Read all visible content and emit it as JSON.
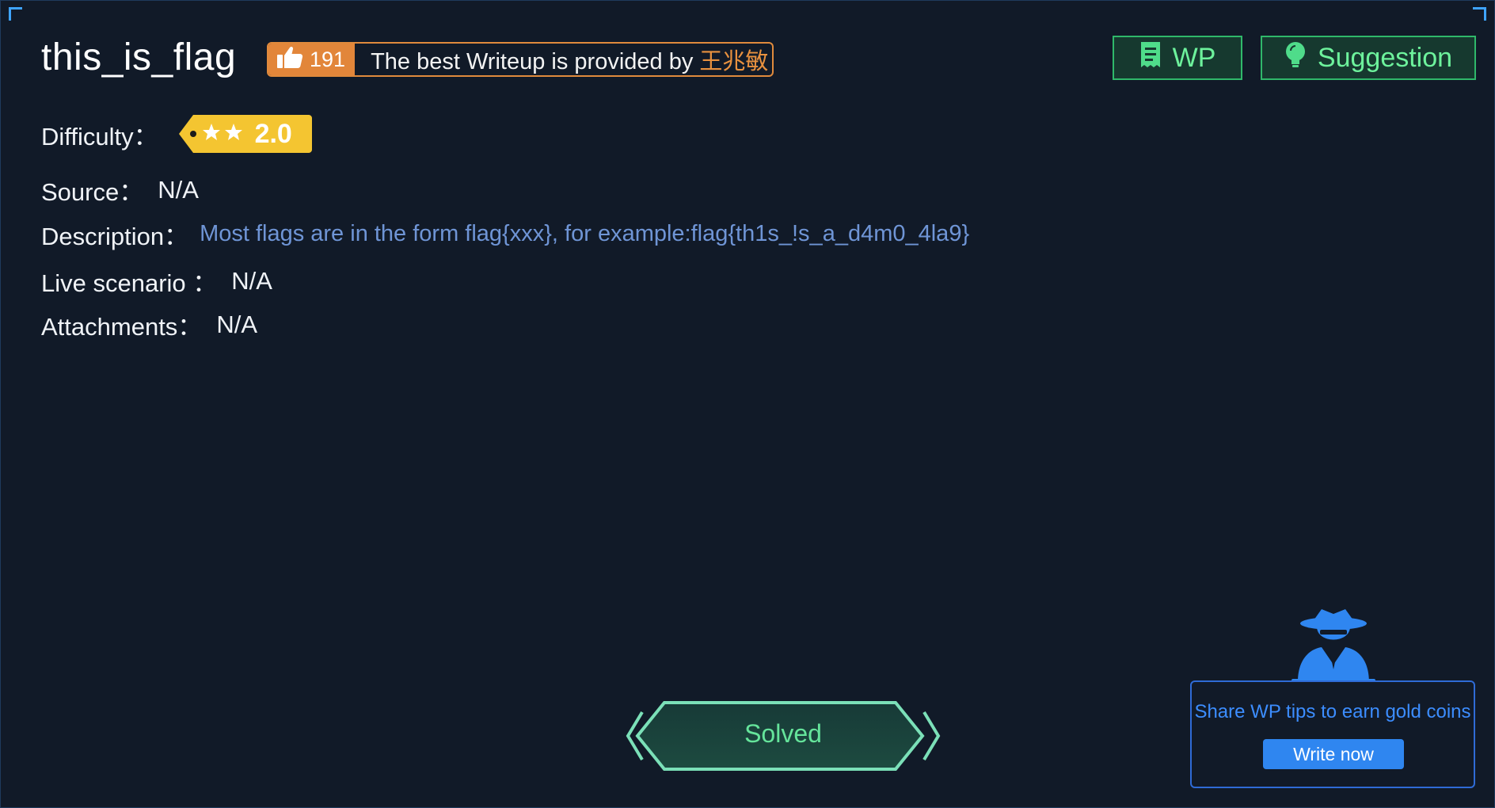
{
  "challenge": {
    "title": "this_is_flag",
    "likes": "191",
    "writeup_text": "The best Writeup is provided by",
    "writeup_author": "王兆敏"
  },
  "buttons": {
    "wp_label": "WP",
    "suggestion_label": "Suggestion"
  },
  "fields": {
    "difficulty_label": "Difficulty：",
    "difficulty_value": "2.0",
    "difficulty_stars": 2,
    "source_label": "Source：",
    "source_value": "N/A",
    "description_label": "Description：",
    "description_value": "Most flags are in the form flag{xxx}, for example:flag{th1s_!s_a_d4m0_4la9}",
    "live_label": "Live scenario ：",
    "live_value": "N/A",
    "attachments_label": "Attachments：",
    "attachments_value": "N/A"
  },
  "status": {
    "solved_label": "Solved"
  },
  "wp_promo": {
    "text": "Share WP tips to earn gold coins",
    "button_label": "Write now"
  },
  "colors": {
    "background": "#111a28",
    "accent_orange": "#e2863a",
    "accent_green": "#2fb86a",
    "accent_blue": "#2f86f0",
    "description_blue": "#6f95d6",
    "difficulty_yellow": "#f4c531"
  },
  "icons": {
    "likes": "thumbs-up-icon",
    "wp": "document-icon",
    "suggestion": "lightbulb-icon",
    "promo": "spy-icon"
  }
}
